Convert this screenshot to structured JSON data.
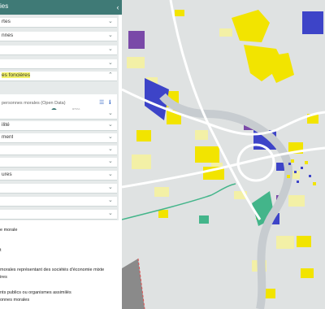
{
  "header": {
    "title": "ies",
    "collapse_icon": "chevron-left-icon"
  },
  "layers": [
    {
      "label": "rtes"
    },
    {
      "label": "nnes"
    },
    {
      "label": ""
    },
    {
      "label": ""
    },
    {
      "label": "es foncières",
      "highlighted": true
    }
  ],
  "sublayer": {
    "label": "personnes morales (Open Data)",
    "opacity_percent": 81,
    "opacity_text": "81%",
    "list_icon": "list-icon",
    "info_icon": "info-icon"
  },
  "layers_lower": [
    {
      "label": ""
    },
    {
      "label": "ilité"
    },
    {
      "label": "ment"
    },
    {
      "label": ""
    },
    {
      "label": ""
    },
    {
      "label": "ures"
    },
    {
      "label": ""
    },
    {
      "label": ""
    },
    {
      "label": ""
    }
  ],
  "legend": [
    "e morale",
    "",
    "t",
    "",
    "morales représentant des sociétés d'économie mixte",
    "ires",
    "",
    "nts publics ou organismes assimilés",
    "onnes morales"
  ],
  "colors": {
    "header": "#3f7a76",
    "yellow": "#f2e400",
    "pale_yellow": "#f3f0a6",
    "blue": "#3d44c8",
    "purple": "#7a49a8",
    "green": "#43b58a",
    "road": "#ffffff",
    "water": "#c7ccd0"
  }
}
